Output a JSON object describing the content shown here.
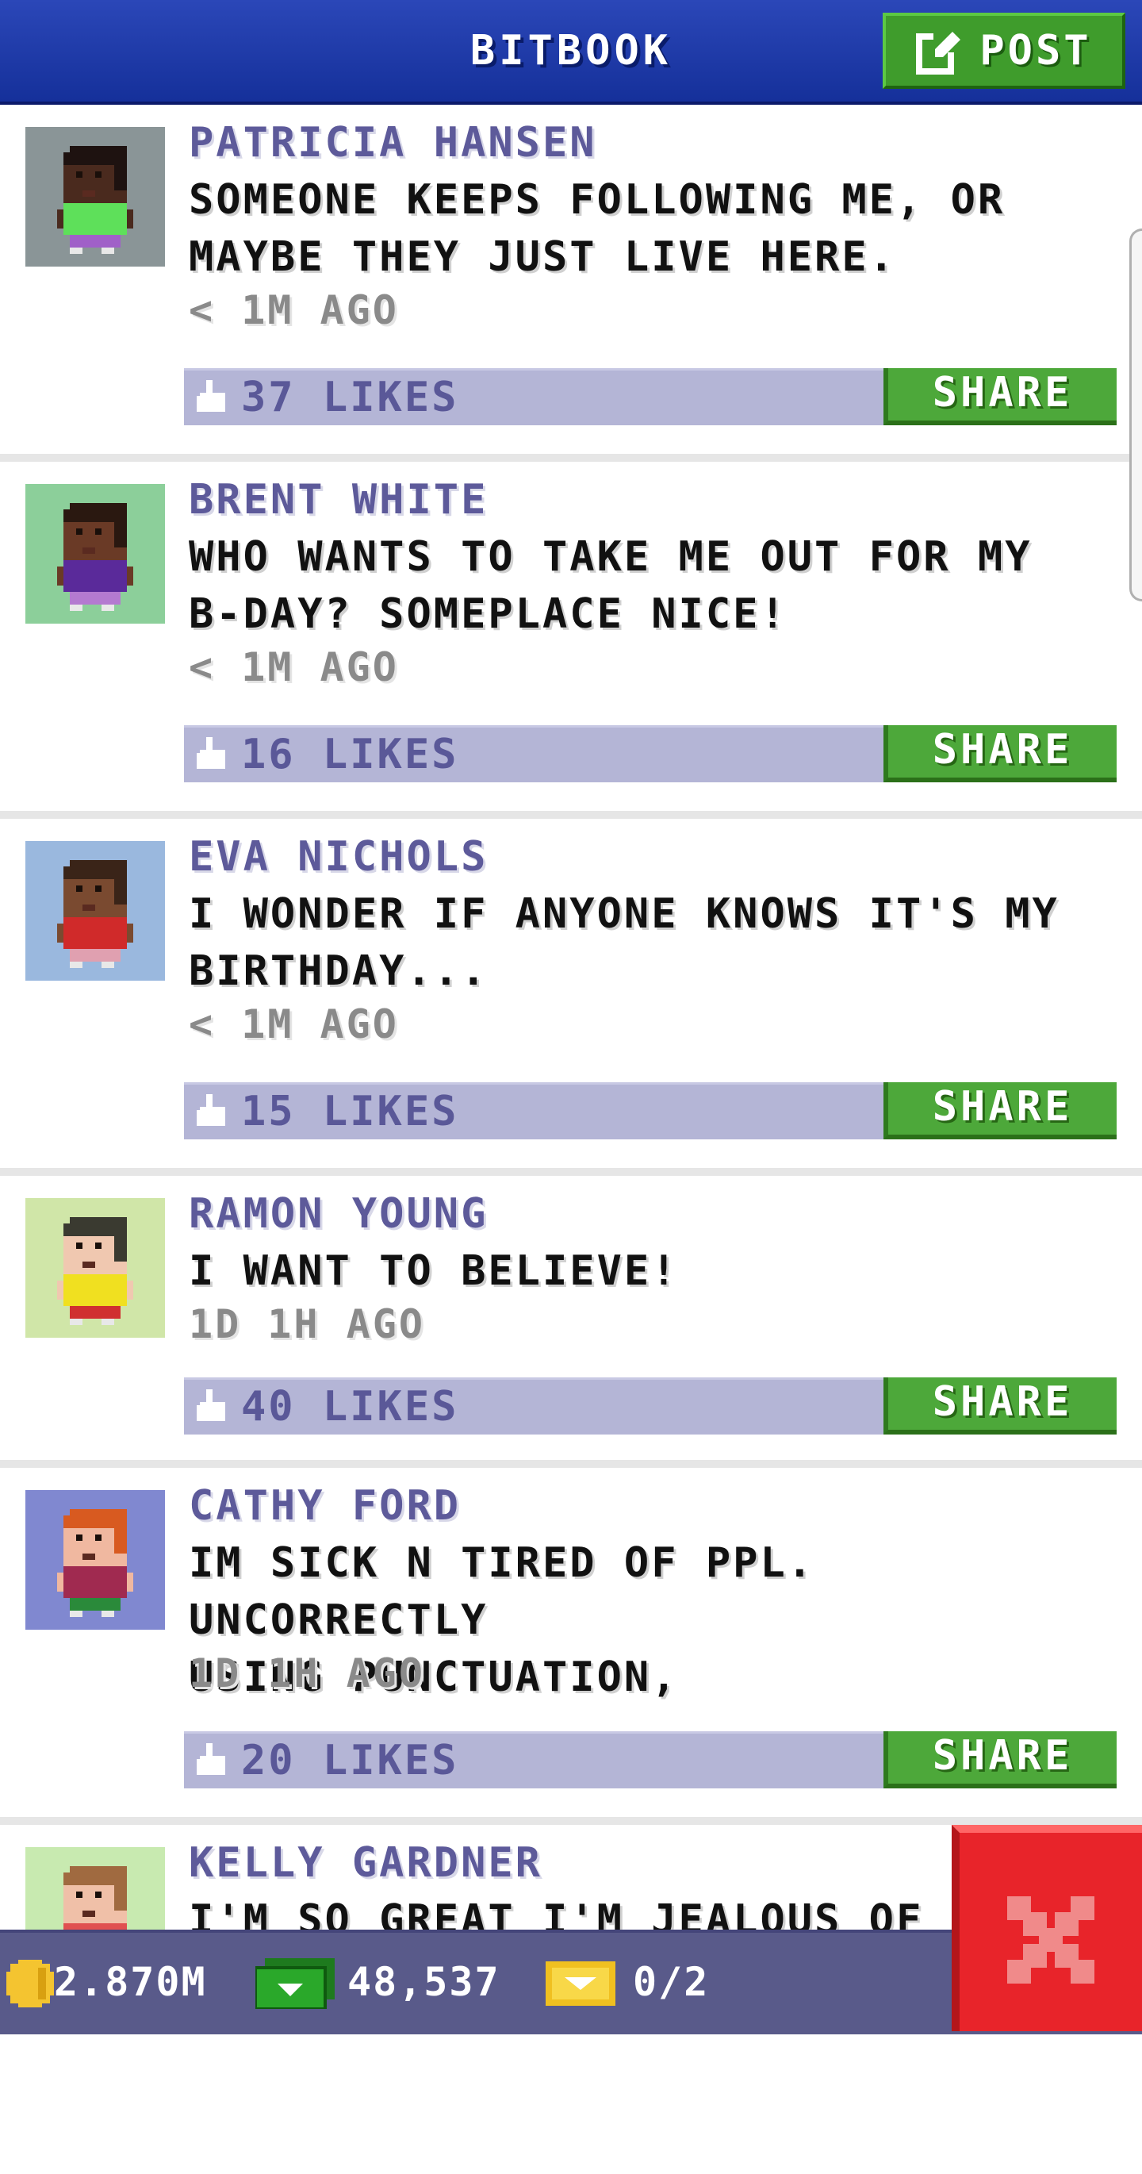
{
  "header": {
    "title": "BITBOOK",
    "post_label": "POST"
  },
  "posts": [
    {
      "name": "PATRICIA HANSEN",
      "message": "SOMEONE KEEPS FOLLOWING ME, OR\nMAYBE THEY JUST LIVE HERE.",
      "time": "< 1M AGO",
      "likes": "37 LIKES",
      "share": "SHARE",
      "avatar_bg": "#8a9597",
      "skin": "#4a2a1e",
      "hair": "#1e1210",
      "shirt": "#5ee05a",
      "pants": "#a060c8"
    },
    {
      "name": "BRENT WHITE",
      "message": "WHO WANTS TO TAKE ME OUT FOR MY\nB-DAY? SOMEPLACE NICE!",
      "time": "< 1M AGO",
      "likes": "16 LIKES",
      "share": "SHARE",
      "avatar_bg": "#8ccf9a",
      "skin": "#6a3a26",
      "hair": "#2a1810",
      "shirt": "#5a2a9a",
      "pants": "#b47ad0"
    },
    {
      "name": "EVA NICHOLS",
      "message": "I WONDER IF ANYONE KNOWS IT'S MY\nBIRTHDAY...",
      "time": "< 1M AGO",
      "likes": "15 LIKES",
      "share": "SHARE",
      "avatar_bg": "#9ab8de",
      "skin": "#7a4a30",
      "hair": "#3a2418",
      "shirt": "#d02a2a",
      "pants": "#e0a0b0"
    },
    {
      "name": "RAMON YOUNG",
      "message": "I WANT TO BELIEVE!",
      "time": "1D 1H AGO",
      "likes": "40 LIKES",
      "share": "SHARE",
      "avatar_bg": "#d0e6a8",
      "skin": "#f0c8b0",
      "hair": "#3a3a30",
      "shirt": "#f0e020",
      "pants": "#d03030"
    },
    {
      "name": "CATHY FORD",
      "message": "IM SICK N TIRED OF PPL. UNCORRECTLY\nUSING PUNCTUATION,",
      "time": "1D 1H AGO",
      "likes": "20 LIKES",
      "share": "SHARE",
      "avatar_bg": "#8088d0",
      "skin": "#f0b8a0",
      "hair": "#d85a20",
      "shirt": "#a02a50",
      "pants": "#2a8a3a"
    },
    {
      "name": "KELLY GARDNER",
      "message": "I'M SO GREAT I'M JEALOUS OF MY",
      "time": "",
      "likes": "",
      "share": "",
      "avatar_bg": "#c8eab0",
      "skin": "#f0c0a8",
      "hair": "#a06a40",
      "shirt": "#e05050",
      "pants": "#e05050"
    }
  ],
  "footer": {
    "coins": "2.870M",
    "bux": "48,537",
    "tickets": "0/2"
  },
  "colors": {
    "accent_green": "#4da83a",
    "header_blue": "#1f3aa8",
    "likes_bar": "#b4b5d6",
    "name_purple": "#5d5a9a",
    "close_red": "#e8242a"
  }
}
